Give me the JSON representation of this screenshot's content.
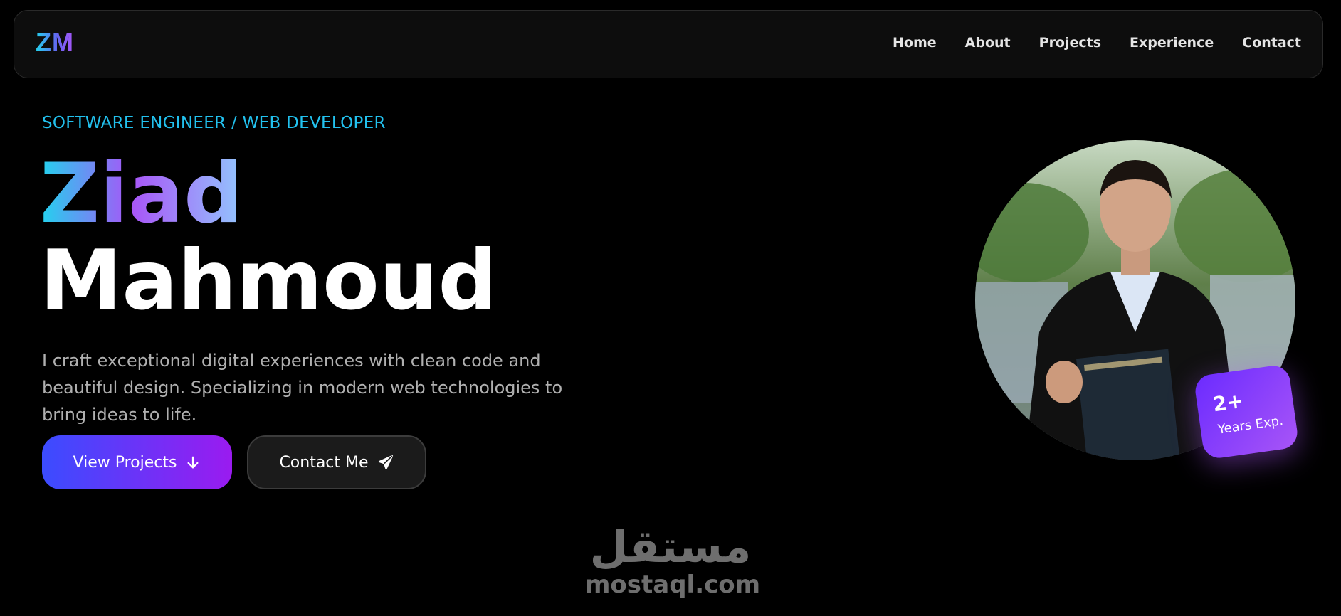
{
  "nav": {
    "logo": "ZM",
    "links": [
      "Home",
      "About",
      "Projects",
      "Experience",
      "Contact"
    ]
  },
  "hero": {
    "subtitle": "SOFTWARE ENGINEER / WEB DEVELOPER",
    "first_name": "Ziad",
    "last_name": "Mahmoud",
    "description": "I craft exceptional digital experiences with clean code and beautiful design. Specializing in modern web technologies to bring ideas to life.",
    "primary_button": "View Projects",
    "secondary_button": "Contact Me"
  },
  "badge": {
    "value": "2+",
    "label": "Years Exp."
  },
  "watermark": {
    "arabic": "مستقل",
    "latin": "mostaql.com"
  },
  "icons": {
    "primary_button": "arrow-down-icon",
    "secondary_button": "send-icon"
  },
  "colors": {
    "accent_cyan": "#22c1ee",
    "accent_purple": "#a855f7",
    "button_gradient_start": "#3b4cff",
    "button_gradient_end": "#9a1bf0",
    "background": "#000000"
  }
}
